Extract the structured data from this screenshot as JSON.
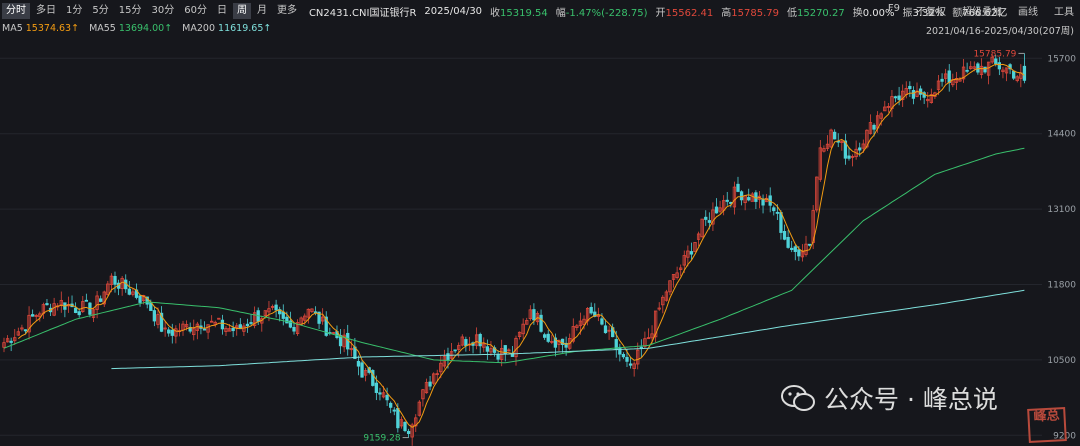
{
  "toolbar": {
    "tabs": [
      "分时",
      "多日",
      "1分",
      "5分",
      "15分",
      "30分",
      "60分",
      "日",
      "周",
      "月",
      "更多"
    ],
    "active_tab": "周",
    "right": [
      "F9",
      "不复权",
      "超级叠加",
      "画线",
      "工具"
    ]
  },
  "quote": {
    "code": "CN2431.CNI国证银行R",
    "date": "2025/04/30",
    "close_label": "收",
    "close": "15319.54",
    "chg_label": "幅",
    "chg": "-1.47%(-228.75)",
    "open_label": "开",
    "open": "15562.41",
    "high_label": "高",
    "high": "15785.79",
    "low_label": "低",
    "low": "15270.27",
    "turn_label": "换",
    "turn": "0.00%",
    "amp_label": "振",
    "amp": "3.32%",
    "amt_label": "额",
    "amt": "766.62亿"
  },
  "ma_legend": [
    {
      "label": "MA5",
      "value": "15374.63↑",
      "color": "#f39c12"
    },
    {
      "label": "MA55",
      "value": "13694.00↑",
      "color": "#39c06c"
    },
    {
      "label": "MA200",
      "value": "11619.65↑",
      "color": "#7fe0dc"
    }
  ],
  "range_label": "2021/04/16-2025/04/30(207周)",
  "watermark": {
    "text": "公众号 · 峰总说",
    "stamp": "峰总"
  },
  "chart_data": {
    "type": "candlestick",
    "period": "weekly",
    "y_ticks": [
      9200,
      10500,
      11800,
      13100,
      14400,
      15700
    ],
    "ylim": [
      9050,
      16050
    ],
    "n_bars": 207,
    "annotations": [
      {
        "text": "15785.79",
        "label": "high",
        "value": 15785.79
      },
      {
        "text": "9159.28",
        "label": "low",
        "value": 9159.28
      }
    ],
    "colors": {
      "up": "#e0483b",
      "down": "#4fd2d8",
      "ma5": "#f39c12",
      "ma55": "#39c06c",
      "ma200": "#7fe0dc",
      "grid": "#24262d"
    },
    "key_closes": [
      [
        0,
        10800
      ],
      [
        5,
        11050
      ],
      [
        10,
        11350
      ],
      [
        15,
        11500
      ],
      [
        20,
        11400
      ],
      [
        25,
        11380
      ],
      [
        30,
        11900
      ],
      [
        35,
        11700
      ],
      [
        40,
        11500
      ],
      [
        45,
        10950
      ],
      [
        50,
        11050
      ],
      [
        55,
        11150
      ],
      [
        60,
        11100
      ],
      [
        65,
        11000
      ],
      [
        70,
        11250
      ],
      [
        75,
        11300
      ],
      [
        80,
        11050
      ],
      [
        85,
        11400
      ],
      [
        90,
        11050
      ],
      [
        95,
        10800
      ],
      [
        100,
        10300
      ],
      [
        105,
        10000
      ],
      [
        110,
        9400
      ],
      [
        113,
        9350
      ],
      [
        117,
        9900
      ],
      [
        122,
        10500
      ],
      [
        127,
        10800
      ],
      [
        132,
        10900
      ],
      [
        137,
        10650
      ],
      [
        142,
        10600
      ],
      [
        147,
        11400
      ],
      [
        152,
        10900
      ],
      [
        157,
        10750
      ],
      [
        162,
        11300
      ],
      [
        165,
        11250
      ],
      [
        170,
        10800
      ],
      [
        175,
        10300
      ],
      [
        180,
        10900
      ],
      [
        185,
        11700
      ],
      [
        190,
        12200
      ],
      [
        195,
        12800
      ],
      [
        200,
        13200
      ],
      [
        205,
        13400
      ],
      [
        210,
        13300
      ],
      [
        215,
        13100
      ],
      [
        220,
        12300
      ],
      [
        225,
        12550
      ],
      [
        228,
        14200
      ],
      [
        231,
        14400
      ],
      [
        236,
        14000
      ],
      [
        241,
        14400
      ],
      [
        246,
        14900
      ],
      [
        251,
        15100
      ],
      [
        256,
        15000
      ],
      [
        261,
        15250
      ],
      [
        266,
        15400
      ],
      [
        271,
        15500
      ],
      [
        276,
        15600
      ],
      [
        281,
        15500
      ],
      [
        285,
        15319.54
      ]
    ],
    "ma55_key": [
      [
        0,
        10700
      ],
      [
        20,
        11200
      ],
      [
        40,
        11500
      ],
      [
        60,
        11400
      ],
      [
        80,
        11150
      ],
      [
        100,
        10800
      ],
      [
        120,
        10500
      ],
      [
        140,
        10450
      ],
      [
        160,
        10650
      ],
      [
        180,
        10750
      ],
      [
        200,
        11200
      ],
      [
        220,
        11700
      ],
      [
        240,
        12900
      ],
      [
        260,
        13700
      ],
      [
        277,
        14050
      ],
      [
        285,
        14150
      ]
    ],
    "ma200_key": [
      [
        30,
        10350
      ],
      [
        60,
        10400
      ],
      [
        100,
        10550
      ],
      [
        140,
        10600
      ],
      [
        180,
        10700
      ],
      [
        220,
        11100
      ],
      [
        260,
        11450
      ],
      [
        285,
        11700
      ]
    ]
  }
}
